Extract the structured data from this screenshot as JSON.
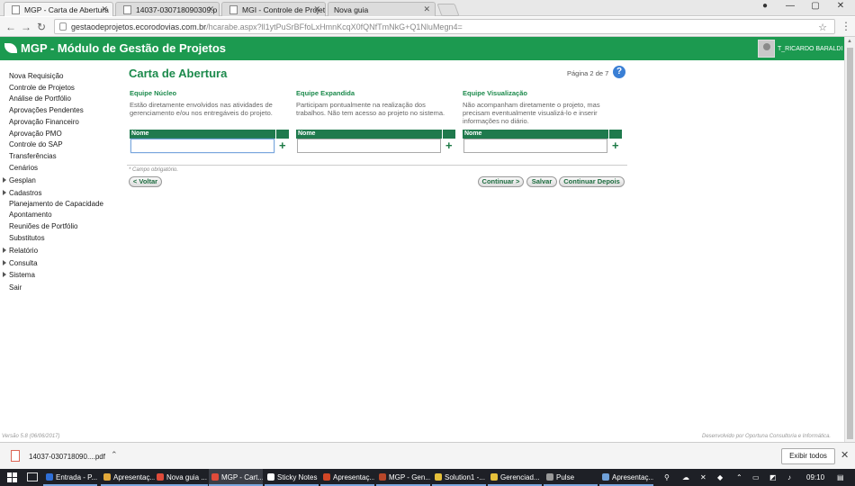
{
  "browser": {
    "tabs": [
      {
        "label": "MGP - Carta de Abertura",
        "active": true
      },
      {
        "label": "14037-030718090309.p",
        "active": false
      },
      {
        "label": "MGI - Controle de Projet",
        "active": false
      },
      {
        "label": "Nova guia",
        "active": false
      }
    ],
    "url_host": "gestaodeprojetos.ecorodovias.com.br",
    "url_path": "/hcarabe.aspx?ll1ytPuSrBFfoLxHmnKcqX0fQNfTmNkG+Q1NluMegn4="
  },
  "app": {
    "title": "MGP - Módulo de Gestão de Projetos",
    "username": "T_RICARDO BARALDI"
  },
  "sidebar": {
    "items": [
      {
        "label": "Nova Requisição",
        "expandable": false
      },
      {
        "label": "Controle de Projetos",
        "expandable": false
      },
      {
        "label": "Análise de Portfólio",
        "expandable": false
      },
      {
        "label": "Aprovações Pendentes",
        "expandable": false
      },
      {
        "label": "Aprovação Financeiro",
        "expandable": false
      },
      {
        "label": "Aprovação PMO",
        "expandable": false
      },
      {
        "label": "Controle do SAP",
        "expandable": false
      },
      {
        "label": "Transferências",
        "expandable": false
      },
      {
        "label": "Cenários",
        "expandable": false
      },
      {
        "label": "Gesplan",
        "expandable": true
      },
      {
        "label": "Cadastros",
        "expandable": true
      },
      {
        "label": "Planejamento de Capacidade",
        "expandable": false
      },
      {
        "label": "Apontamento",
        "expandable": false
      },
      {
        "label": "Reuniões de Portfólio",
        "expandable": false
      },
      {
        "label": "Substitutos",
        "expandable": false
      },
      {
        "label": "Relatório",
        "expandable": true
      },
      {
        "label": "Consulta",
        "expandable": true
      },
      {
        "label": "Sistema",
        "expandable": true
      },
      {
        "label": "Sair",
        "expandable": false
      }
    ]
  },
  "main": {
    "title": "Carta de Abertura",
    "page_info": "Página 2 de 7",
    "help": "?",
    "teams": [
      {
        "title": "Equipe Núcleo",
        "description": "Estão diretamente envolvidos nas atividades de gerenciamento e/ou nos entregáveis do projeto.",
        "column_header": "Nome",
        "value": ""
      },
      {
        "title": "Equipe Expandida",
        "description": "Participam pontualmente na realização dos trabalhos. Não tem acesso ao projeto no sistema.",
        "column_header": "Nome",
        "value": ""
      },
      {
        "title": "Equipe Visualização",
        "description": "Não acompanham diretamente o projeto, mas precisam eventualmente visualizá-lo e inserir informações no diário.",
        "column_header": "Nome",
        "value": ""
      }
    ],
    "add_symbol": "+",
    "required_note": "* Campo obrigatório.",
    "buttons": {
      "back": "< Voltar",
      "continue": "Continuar >",
      "save": "Salvar",
      "continue_later": "Continuar Depois"
    }
  },
  "footer": {
    "version": "Versão 5.8 (06/06/2017)",
    "developer": "Desenvolvido por Oportuna Consultoria e Informática."
  },
  "downloads": {
    "file": "14037-030718090....pdf",
    "show_all": "Exibir todos"
  },
  "taskbar": {
    "items": [
      {
        "label": "Entrada - P...",
        "color": "#2f6fd6"
      },
      {
        "label": "Apresentaç...",
        "color": "#e2a93b"
      },
      {
        "label": "Nova guia ...",
        "color": "#e04b3a"
      },
      {
        "label": "MGP - Cart...",
        "color": "#e04b3a"
      },
      {
        "label": "Sticky Notes",
        "color": "#ffffff"
      },
      {
        "label": "Apresentaç...",
        "color": "#d24726"
      },
      {
        "label": "MGP - Gen...",
        "color": "#b7472a"
      },
      {
        "label": "Solution1 -...",
        "color": "#e6c13b"
      },
      {
        "label": "Gerenciad...",
        "color": "#e6c13b"
      },
      {
        "label": "Pulse",
        "color": "#999999"
      },
      {
        "label": "Apresentaç...",
        "color": "#6fa0d8"
      }
    ],
    "clock": "09:10"
  }
}
